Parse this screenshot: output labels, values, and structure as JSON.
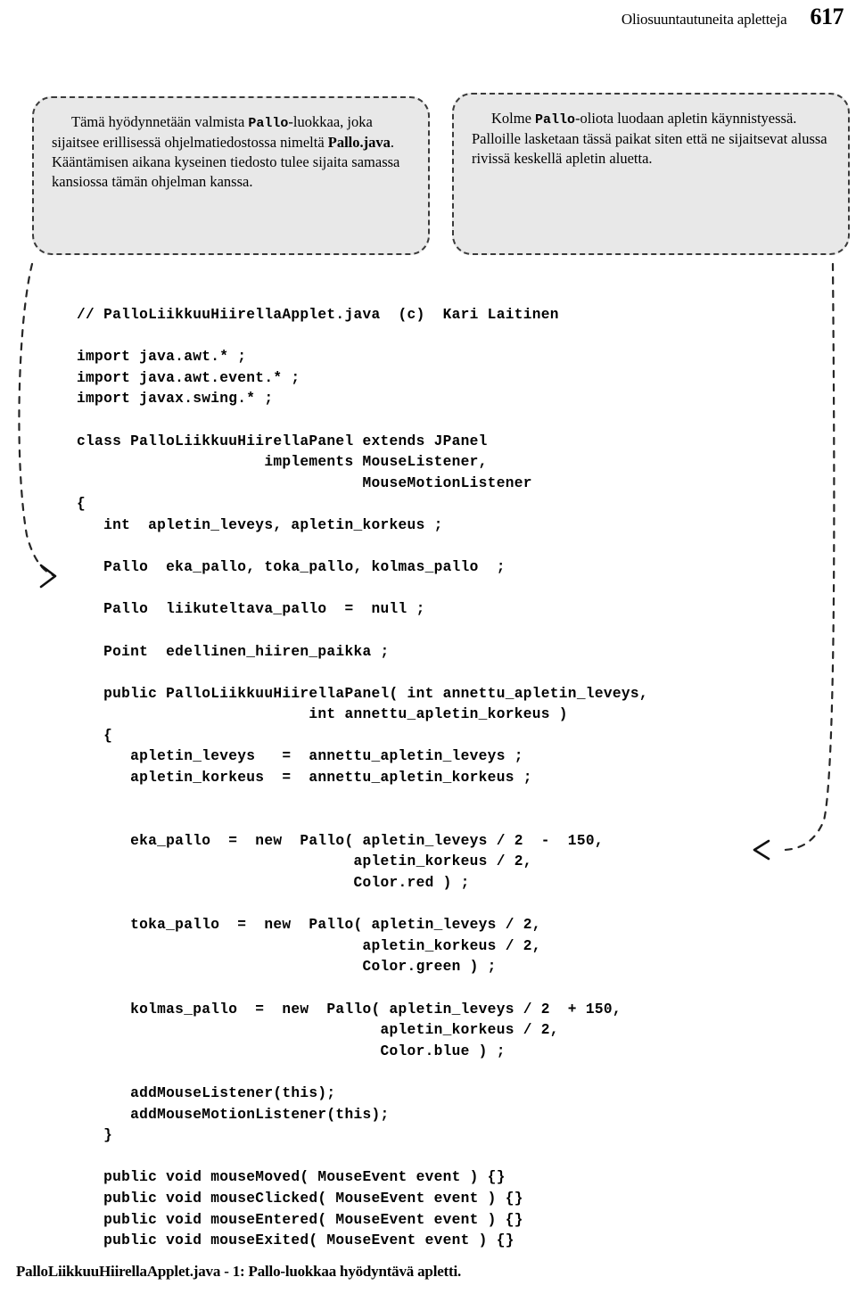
{
  "header": {
    "title": "Oliosuuntautuneita apletteja",
    "page_number": "617"
  },
  "callouts": {
    "left": {
      "name": "callout-pallo-luokka",
      "text_before_mono": "Tämä hyödynnetään valmista ",
      "mono1": "Pallo",
      "text_mid": "-luokkaa, joka sijaitsee erillisessä ohjelmatiedostossa nimeltä ",
      "bold1": "Pallo.java",
      "text_after": ". Kääntämisen aikana kyseinen tiedosto tulee sijaita samassa kansiossa tämän ohjelman kanssa."
    },
    "right": {
      "name": "callout-kolme-palloa",
      "text_before_mono": "Kolme ",
      "mono1": "Pallo",
      "text_after": "-oliota luodaan apletin käynnistyessä. Palloille lasketaan tässä paikat siten että ne sijaitsevat alussa rivissä keskellä apletin aluetta."
    }
  },
  "code": {
    "language": "java",
    "lines": [
      "  // PalloLiikkuuHiirellaApplet.java  (c)  Kari Laitinen",
      "",
      "  import java.awt.* ;",
      "  import java.awt.event.* ;",
      "  import javax.swing.* ;",
      "",
      "  class PalloLiikkuuHiirellaPanel extends JPanel",
      "                       implements MouseListener,",
      "                                  MouseMotionListener",
      "  {",
      "     int  apletin_leveys, apletin_korkeus ;",
      "",
      "     Pallo  eka_pallo, toka_pallo, kolmas_pallo  ;",
      "",
      "     Pallo  liikuteltava_pallo  =  null ;",
      "",
      "     Point  edellinen_hiiren_paikka ;",
      "",
      "     public PalloLiikkuuHiirellaPanel( int annettu_apletin_leveys,",
      "                            int annettu_apletin_korkeus )",
      "     {",
      "        apletin_leveys   =  annettu_apletin_leveys ;",
      "        apletin_korkeus  =  annettu_apletin_korkeus ;",
      "",
      "",
      "        eka_pallo  =  new  Pallo( apletin_leveys / 2  -  150,",
      "                                 apletin_korkeus / 2,",
      "                                 Color.red ) ;",
      "",
      "        toka_pallo  =  new  Pallo( apletin_leveys / 2,",
      "                                  apletin_korkeus / 2,",
      "                                  Color.green ) ;",
      "",
      "        kolmas_pallo  =  new  Pallo( apletin_leveys / 2  + 150,",
      "                                    apletin_korkeus / 2,",
      "                                    Color.blue ) ;",
      "",
      "        addMouseListener(this);",
      "        addMouseMotionListener(this);",
      "     }",
      "",
      "     public void mouseMoved( MouseEvent event ) {}",
      "     public void mouseClicked( MouseEvent event ) {}",
      "     public void mouseEntered( MouseEvent event ) {}",
      "     public void mouseExited( MouseEvent event ) {}"
    ]
  },
  "caption": {
    "text": "PalloLiikkuuHiirellaApplet.java - 1:  Pallo-luokkaa hyödyntävä apletti."
  },
  "colors": {
    "callout_fill": "#e8e8e8",
    "callout_border": "#3a3a3a",
    "text": "#000000",
    "page_background": "#ffffff"
  }
}
